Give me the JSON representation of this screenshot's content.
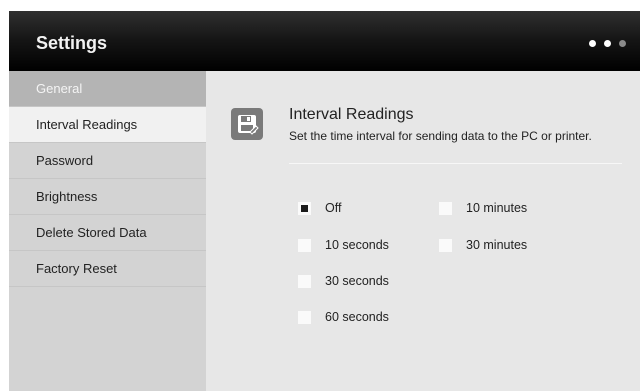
{
  "header": {
    "title": "Settings",
    "pager": {
      "pages": 3,
      "current": 1
    }
  },
  "sidebar": {
    "items": [
      {
        "label": "General",
        "type": "header"
      },
      {
        "label": "Interval Readings",
        "active": true
      },
      {
        "label": "Password"
      },
      {
        "label": "Brightness"
      },
      {
        "label": "Delete Stored Data"
      },
      {
        "label": "Factory Reset"
      }
    ]
  },
  "content": {
    "icon": "save-data-icon",
    "title": "Interval Readings",
    "description": "Set the time interval for sending data to the PC or printer.",
    "options": [
      {
        "label": "Off",
        "checked": true
      },
      {
        "label": "10 seconds",
        "checked": false
      },
      {
        "label": "30 seconds",
        "checked": false
      },
      {
        "label": "60 seconds",
        "checked": false
      },
      {
        "label": "10 minutes",
        "checked": false
      },
      {
        "label": "30 minutes",
        "checked": false
      }
    ]
  }
}
